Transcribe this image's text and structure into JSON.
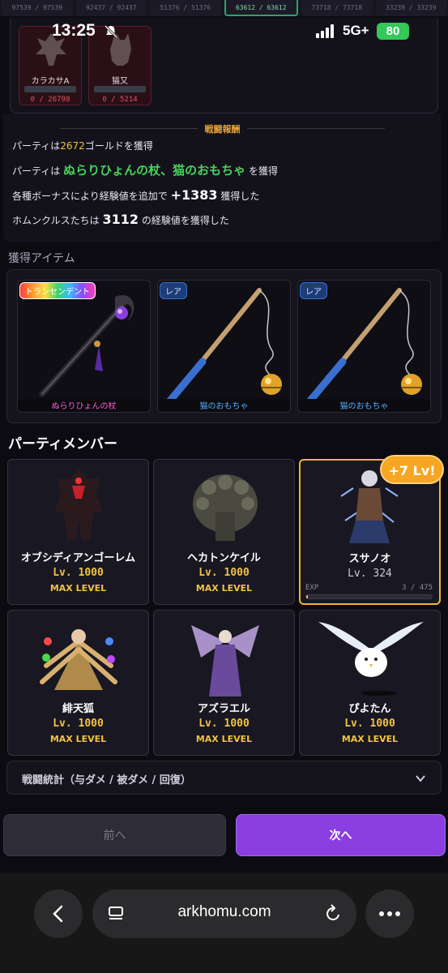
{
  "top_strip": [
    "97539 / 97539",
    "92437 / 92437",
    "51376 / 51376",
    "63612 / 63612",
    "73718 / 73718",
    "33239 / 33239"
  ],
  "status": {
    "time": "13:25",
    "network": "5G+",
    "battery": "80"
  },
  "enemies": [
    {
      "name": "カラカサA",
      "hp": "0 / 26798"
    },
    {
      "name": "猫又",
      "hp": "0 / 5214"
    }
  ],
  "report": {
    "title": "戦闘報酬",
    "line1_pre": "パーティは",
    "line1_gold": "2672",
    "line1_post": "ゴールドを獲得",
    "line2_pre": "パーティは",
    "line2_items": "ぬらりひょんの杖、猫のおもちゃ",
    "line2_post": "を獲得",
    "line3_pre": "各種ボーナスにより経験値を追加で",
    "line3_value": "+1383",
    "line3_post": "獲得した",
    "line4_pre": "ホムンクルスたちは",
    "line4_value": "3112",
    "line4_post": "の経験値を獲得した"
  },
  "items_heading": "獲得アイテム",
  "items": [
    {
      "badge": "トランセンデント",
      "name": "ぬらりひょんの杖"
    },
    {
      "badge": "レア",
      "name": "猫のおもちゃ"
    },
    {
      "badge": "レア",
      "name": "猫のおもちゃ"
    }
  ],
  "party_heading": "パーティメンバー",
  "level_up_badge": "+7 Lv!",
  "members": [
    {
      "name": "オブシディアンゴーレム",
      "level": "Lv. 1000",
      "status": "MAX LEVEL"
    },
    {
      "name": "ヘカトンケイル",
      "level": "Lv. 1000",
      "status": "MAX LEVEL"
    },
    {
      "name": "スサノオ",
      "level": "Lv. 324",
      "exp_label": "EXP",
      "exp_value": "3 / 475",
      "exp_fraction": 0.006
    },
    {
      "name": "緋天狐",
      "level": "Lv. 1000",
      "status": "MAX LEVEL"
    },
    {
      "name": "アズラエル",
      "level": "Lv. 1000",
      "status": "MAX LEVEL"
    },
    {
      "name": "ぴよたん",
      "level": "Lv. 1000",
      "status": "MAX LEVEL"
    }
  ],
  "stats_accordion": "戦闘統計（与ダメ / 被ダメ / 回復）",
  "nav": {
    "prev": "前へ",
    "next": "次へ"
  },
  "browser": {
    "url": "arkhomu.com"
  },
  "colors": {
    "accent": "#8a3ee0",
    "gold": "#f2c244",
    "green": "#46d35a",
    "level_badge": "#f6a623"
  }
}
